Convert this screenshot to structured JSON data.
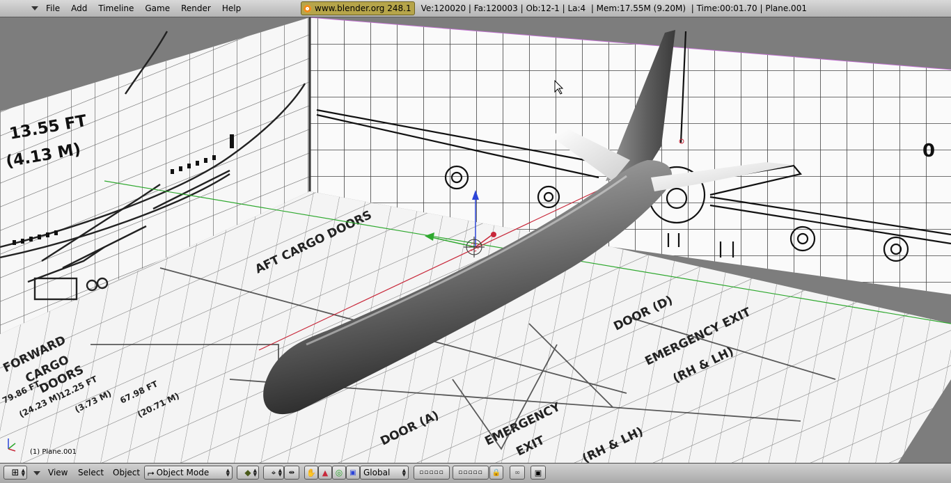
{
  "top_menu": {
    "items": [
      "File",
      "Add",
      "Timeline",
      "Game",
      "Render",
      "Help"
    ]
  },
  "info": {
    "version": "www.blender.org 248.1",
    "stats": "Ve:120020 | Fa:120003 | Ob:12-1 | La:4  | Mem:17.55M (9.20M)  | Time:00:01.70 | Plane.001"
  },
  "viewport": {
    "object_label": "(1) Plane.001",
    "blueprint_text": {
      "height_ft": "13.55 FT",
      "height_m": "(4.13 M)",
      "aft_cargo": "AFT CARGO DOORS",
      "forward_cargo": "FORWARD",
      "cargo": "CARGO",
      "doors": "DOORS",
      "door_d": "DOOR (D)",
      "door_a": "DOOR (A)",
      "emergency_exit": "EMERGENCY EXIT",
      "emergency": "EMERGENCY",
      "exit": "EXIT",
      "rh_lh": "(RH & LH)",
      "dim1": "79.86 FT",
      "dim2": "(24.23 M)",
      "dim3": "12.25 FT",
      "dim4": "(3.73 M)",
      "dim5": "67.98 FT",
      "dim6": "(20.71 M)",
      "zero": "0"
    }
  },
  "bottom_bar": {
    "view": "View",
    "select": "Select",
    "object": "Object",
    "mode": "Object Mode",
    "orientation": "Global"
  },
  "colors": {
    "info_badge": "#b6a54a",
    "x_axis": "#c8283a",
    "y_axis": "#2ea82e",
    "z_axis": "#2c44d8"
  }
}
